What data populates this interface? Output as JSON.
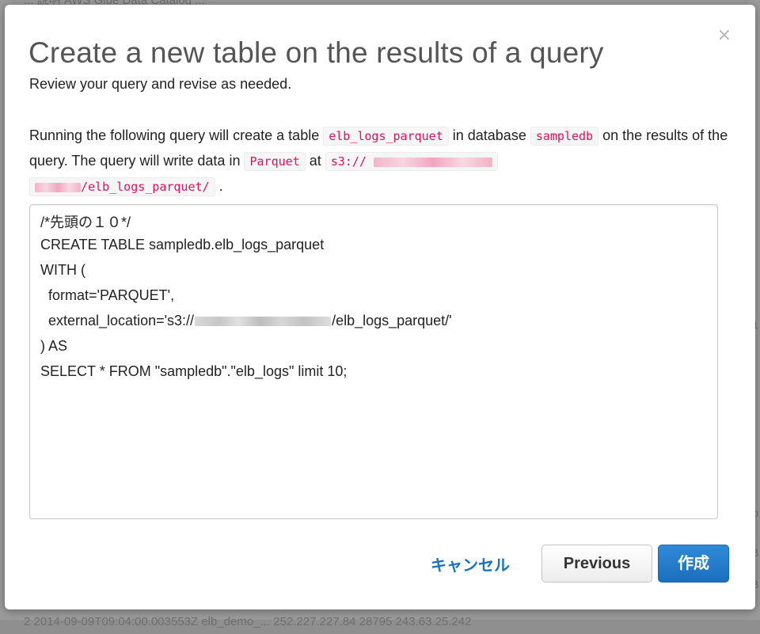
{
  "background": {
    "top_strip_text": "...  説明      AWS Glue Data Catalog ...",
    "bottom_strip_text": "2  2014-09-09T09:04:00.003553Z  elb_demo_...  252.227.227.84    28795        243.63.25.242",
    "edge_chars": [
      "1",
      "o",
      "3",
      "3"
    ]
  },
  "dialog": {
    "close_symbol": "×",
    "title": "Create a new table on the results of a query",
    "subtitle": "Review your query and revise as needed.",
    "description": {
      "p1": "Running the following query will create a table",
      "table_name": "elb_logs_parquet",
      "p2": "in database",
      "database": "sampledb",
      "p3": "on the results of the query. The query will write data in",
      "format": "Parquet",
      "p4": "at",
      "location_prefix": "s3://",
      "location_suffix": "/elb_logs_parquet/",
      "p5": "."
    },
    "query_lines": {
      "l1": "/*先頭の１０*/",
      "l2": "CREATE TABLE sampledb.elb_logs_parquet",
      "l3": "WITH (",
      "l4": "  format='PARQUET',",
      "l5_prefix": "  external_location='s3://",
      "l5_suffix": "/elb_logs_parquet/'",
      "l6": ") AS",
      "l7": "SELECT * FROM \"sampledb\".\"elb_logs\" limit 10;"
    },
    "buttons": {
      "cancel": "キャンセル",
      "previous": "Previous",
      "create": "作成"
    }
  },
  "colors": {
    "accent": "#1a73c2",
    "primary_button": "#1b6fbd",
    "code_text": "#e0115f"
  }
}
